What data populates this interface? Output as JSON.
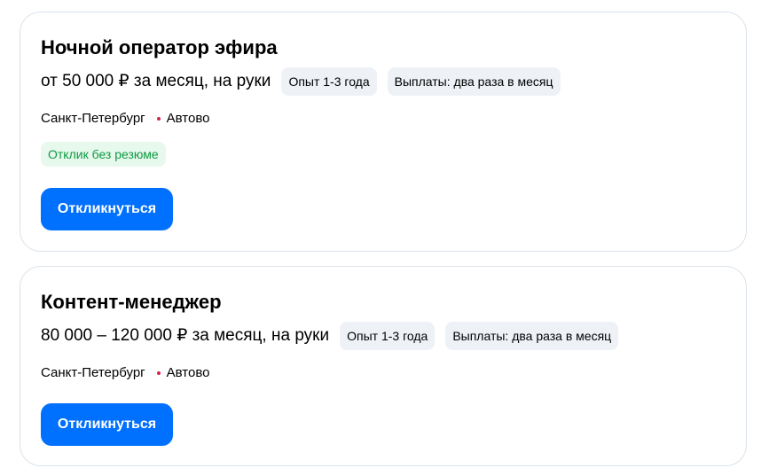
{
  "vacancies": [
    {
      "title": "Ночной оператор эфира",
      "salary": "от 50 000 ₽ за месяц, на руки",
      "tags": [
        "Опыт 1-3 года",
        "Выплаты: два раза в месяц"
      ],
      "city": "Санкт-Петербург",
      "metro": "Автово",
      "badge": "Отклик без резюме",
      "apply_label": "Откликнуться"
    },
    {
      "title": "Контент-менеджер",
      "salary": "80 000 – 120 000 ₽ за месяц, на руки",
      "tags": [
        "Опыт 1-3 года",
        "Выплаты: два раза в месяц"
      ],
      "city": "Санкт-Петербург",
      "metro": "Автово",
      "apply_label": "Откликнуться"
    }
  ],
  "colors": {
    "accent": "#0070ff",
    "metro_dot": "#d6214a",
    "badge_bg": "#e7f8ec",
    "badge_text": "#0d9b43",
    "tag_bg": "#eef2f7",
    "card_border": "#dce3eb"
  }
}
